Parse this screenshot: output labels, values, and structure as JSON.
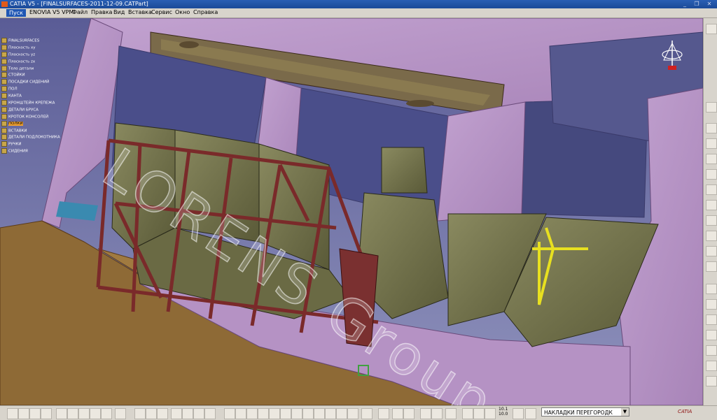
{
  "window": {
    "title": "CATIA V5 - [FINALSURFACES-2011-12-09.CATPart]",
    "controls": [
      "_",
      "❐",
      "✕"
    ]
  },
  "menu": {
    "items": [
      "Пуск",
      "ENOVIA V5 VPM",
      "Файл",
      "Правка",
      "Вид",
      "Вставка",
      "Сервис",
      "Окно",
      "Справка"
    ]
  },
  "tree": {
    "nodes": [
      {
        "label": "FINALSURFACES",
        "selected": false
      },
      {
        "label": "Плоскость xy",
        "selected": false
      },
      {
        "label": "Плоскость yz",
        "selected": false
      },
      {
        "label": "Плоскость zx",
        "selected": false
      },
      {
        "label": "Тело детали",
        "selected": false
      },
      {
        "label": "СТОЙКИ",
        "selected": false
      },
      {
        "label": "ПОСАДКИ СИДЕНИЙ",
        "selected": false
      },
      {
        "label": "ПОЛ",
        "selected": false
      },
      {
        "label": "КАНТА",
        "selected": false
      },
      {
        "label": "КРОНШТЕЙН КРЕПЕЖА",
        "selected": false
      },
      {
        "label": "ДЕТАЛИ БРУСА",
        "selected": false
      },
      {
        "label": "КРОТОК КОНСОЛЕЙ",
        "selected": false
      },
      {
        "label": "ПОЛКИ",
        "selected": true
      },
      {
        "label": "ВСТАВКИ",
        "selected": false
      },
      {
        "label": "ДЕТАЛИ ПОДЛОКОТНИКА",
        "selected": false
      },
      {
        "label": "РУЧКИ",
        "selected": false
      },
      {
        "label": "СИДЕНИЯ",
        "selected": false
      }
    ]
  },
  "watermark": "LORENS Group",
  "toolbar": {
    "zoom_value_top": "10.1",
    "zoom_value_bottom": "10.0",
    "selection_dropdown": "НАКЛАДКИ ПЕРЕГОРОДК"
  },
  "brand": "CATIA"
}
